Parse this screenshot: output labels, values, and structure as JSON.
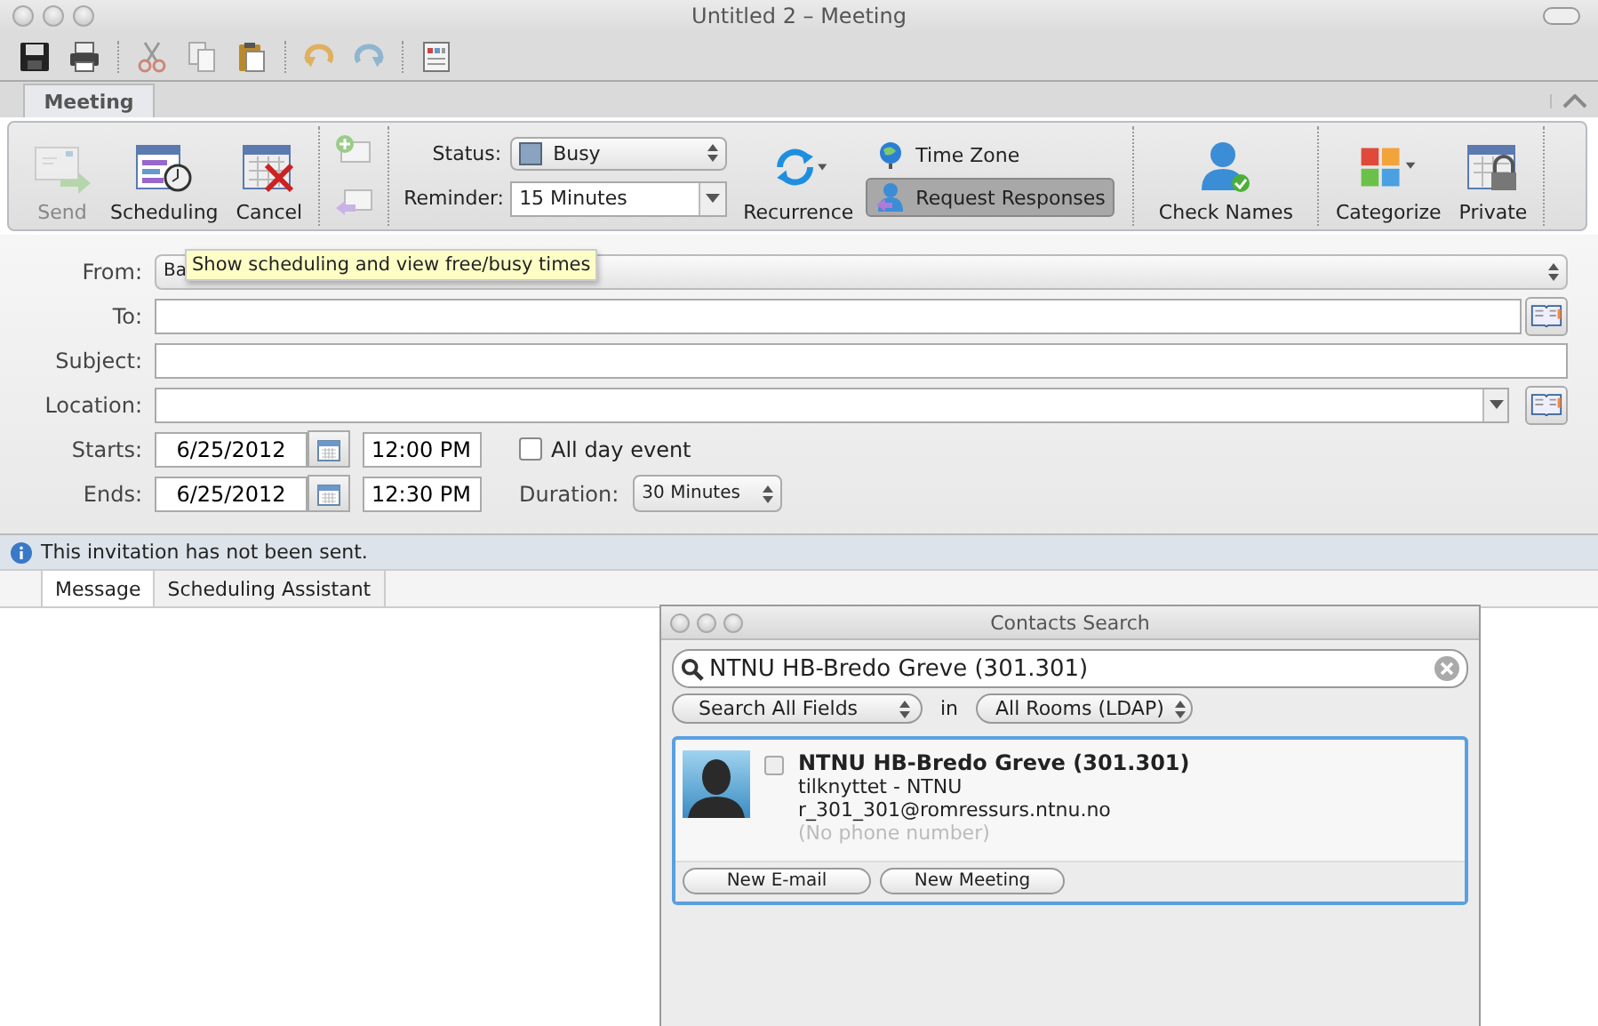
{
  "window": {
    "title": "Untitled 2 – Meeting"
  },
  "ribbon": {
    "tabs": [
      {
        "label": "Meeting",
        "selected": true
      }
    ],
    "big_buttons": [
      {
        "kind": "send",
        "label": "Send",
        "disabled": true
      },
      {
        "kind": "scheduling",
        "label": "Scheduling",
        "disabled": false
      },
      {
        "kind": "cancel",
        "label": "Cancel",
        "disabled": false
      }
    ],
    "status": {
      "label": "Status:",
      "value": "Busy"
    },
    "reminder": {
      "label": "Reminder:",
      "value": "15 Minutes"
    },
    "recurrence": {
      "label": "Recurrence"
    },
    "time_zone": {
      "label": "Time Zone"
    },
    "request_responses": {
      "label": "Request Responses",
      "selected": true
    },
    "check_names": {
      "label": "Check Names"
    },
    "categorize": {
      "label": "Categorize"
    },
    "private": {
      "label": "Private"
    }
  },
  "tooltip": "Show scheduling and view free/busy times",
  "form": {
    "from": {
      "label": "From:",
      "value": "Ba"
    },
    "to": {
      "label": "To:"
    },
    "subject": {
      "label": "Subject:"
    },
    "location": {
      "label": "Location:"
    },
    "starts": {
      "label": "Starts:",
      "date": "6/25/2012",
      "time": "12:00 PM"
    },
    "all_day": {
      "label": "All day event",
      "checked": false
    },
    "ends": {
      "label": "Ends:",
      "date": "6/25/2012",
      "time": "12:30 PM"
    },
    "duration": {
      "label": "Duration:",
      "value": "30 Minutes"
    }
  },
  "info": "This invitation has not been sent.",
  "tabs": [
    {
      "label": "Message",
      "selected": true
    },
    {
      "label": "Scheduling Assistant",
      "selected": false
    }
  ],
  "contacts": {
    "title": "Contacts Search",
    "search": "NTNU HB-Bredo Greve (301.301)",
    "field": "Search All Fields",
    "in": "in",
    "source": "All Rooms  (LDAP)",
    "result": {
      "name": "NTNU HB-Bredo Greve (301.301)",
      "affiliation": "tilknyttet - NTNU",
      "email": "r_301_301@romressurs.ntnu.no",
      "phone": "(No phone number)",
      "checked": false
    },
    "buttons": [
      "New E-mail",
      "New Meeting"
    ]
  }
}
